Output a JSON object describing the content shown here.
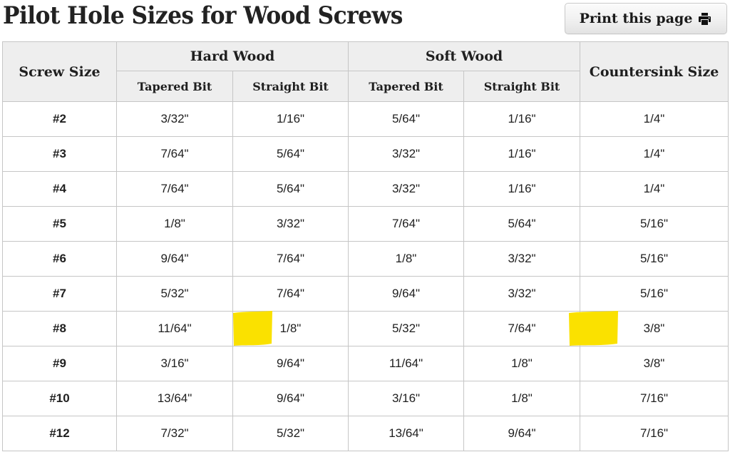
{
  "header": {
    "title": "Pilot Hole Sizes for Wood Screws",
    "print_button_label": "Print this page",
    "print_icon": "printer-icon"
  },
  "table": {
    "group_headers": {
      "screw_size": "Screw Size",
      "hard_wood": "Hard Wood",
      "soft_wood": "Soft Wood",
      "countersink_size": "Countersink Size"
    },
    "sub_headers": {
      "hard_tapered": "Tapered Bit",
      "hard_straight": "Straight Bit",
      "soft_tapered": "Tapered Bit",
      "soft_straight": "Straight Bit"
    },
    "columns": [
      "Screw Size",
      "Hard Wood / Tapered Bit",
      "Hard Wood / Straight Bit",
      "Soft Wood / Tapered Bit",
      "Soft Wood / Straight Bit",
      "Countersink Size"
    ],
    "highlight_color": "#fae100",
    "rows": [
      {
        "screw_size": "#2",
        "hard_tapered": "3/32\"",
        "hard_straight": "1/16\"",
        "soft_tapered": "5/64\"",
        "soft_straight": "1/16\"",
        "countersink": "1/4\"",
        "highlighted": []
      },
      {
        "screw_size": "#3",
        "hard_tapered": "7/64\"",
        "hard_straight": "5/64\"",
        "soft_tapered": "3/32\"",
        "soft_straight": "1/16\"",
        "countersink": "1/4\"",
        "highlighted": []
      },
      {
        "screw_size": "#4",
        "hard_tapered": "7/64\"",
        "hard_straight": "5/64\"",
        "soft_tapered": "3/32\"",
        "soft_straight": "1/16\"",
        "countersink": "1/4\"",
        "highlighted": []
      },
      {
        "screw_size": "#5",
        "hard_tapered": "1/8\"",
        "hard_straight": "3/32\"",
        "soft_tapered": "7/64\"",
        "soft_straight": "5/64\"",
        "countersink": "5/16\"",
        "highlighted": []
      },
      {
        "screw_size": "#6",
        "hard_tapered": "9/64\"",
        "hard_straight": "7/64\"",
        "soft_tapered": "1/8\"",
        "soft_straight": "3/32\"",
        "countersink": "5/16\"",
        "highlighted": []
      },
      {
        "screw_size": "#7",
        "hard_tapered": "5/32\"",
        "hard_straight": "7/64\"",
        "soft_tapered": "9/64\"",
        "soft_straight": "3/32\"",
        "countersink": "5/16\"",
        "highlighted": []
      },
      {
        "screw_size": "#8",
        "hard_tapered": "11/64\"",
        "hard_straight": "1/8\"",
        "soft_tapered": "5/32\"",
        "soft_straight": "7/64\"",
        "countersink": "3/8\"",
        "highlighted": [
          "hard_straight",
          "countersink"
        ]
      },
      {
        "screw_size": "#9",
        "hard_tapered": "3/16\"",
        "hard_straight": "9/64\"",
        "soft_tapered": "11/64\"",
        "soft_straight": "1/8\"",
        "countersink": "3/8\"",
        "highlighted": []
      },
      {
        "screw_size": "#10",
        "hard_tapered": "13/64\"",
        "hard_straight": "9/64\"",
        "soft_tapered": "3/16\"",
        "soft_straight": "1/8\"",
        "countersink": "7/16\"",
        "highlighted": []
      },
      {
        "screw_size": "#12",
        "hard_tapered": "7/32\"",
        "hard_straight": "5/32\"",
        "soft_tapered": "13/64\"",
        "soft_straight": "9/64\"",
        "countersink": "7/16\"",
        "highlighted": []
      }
    ]
  }
}
